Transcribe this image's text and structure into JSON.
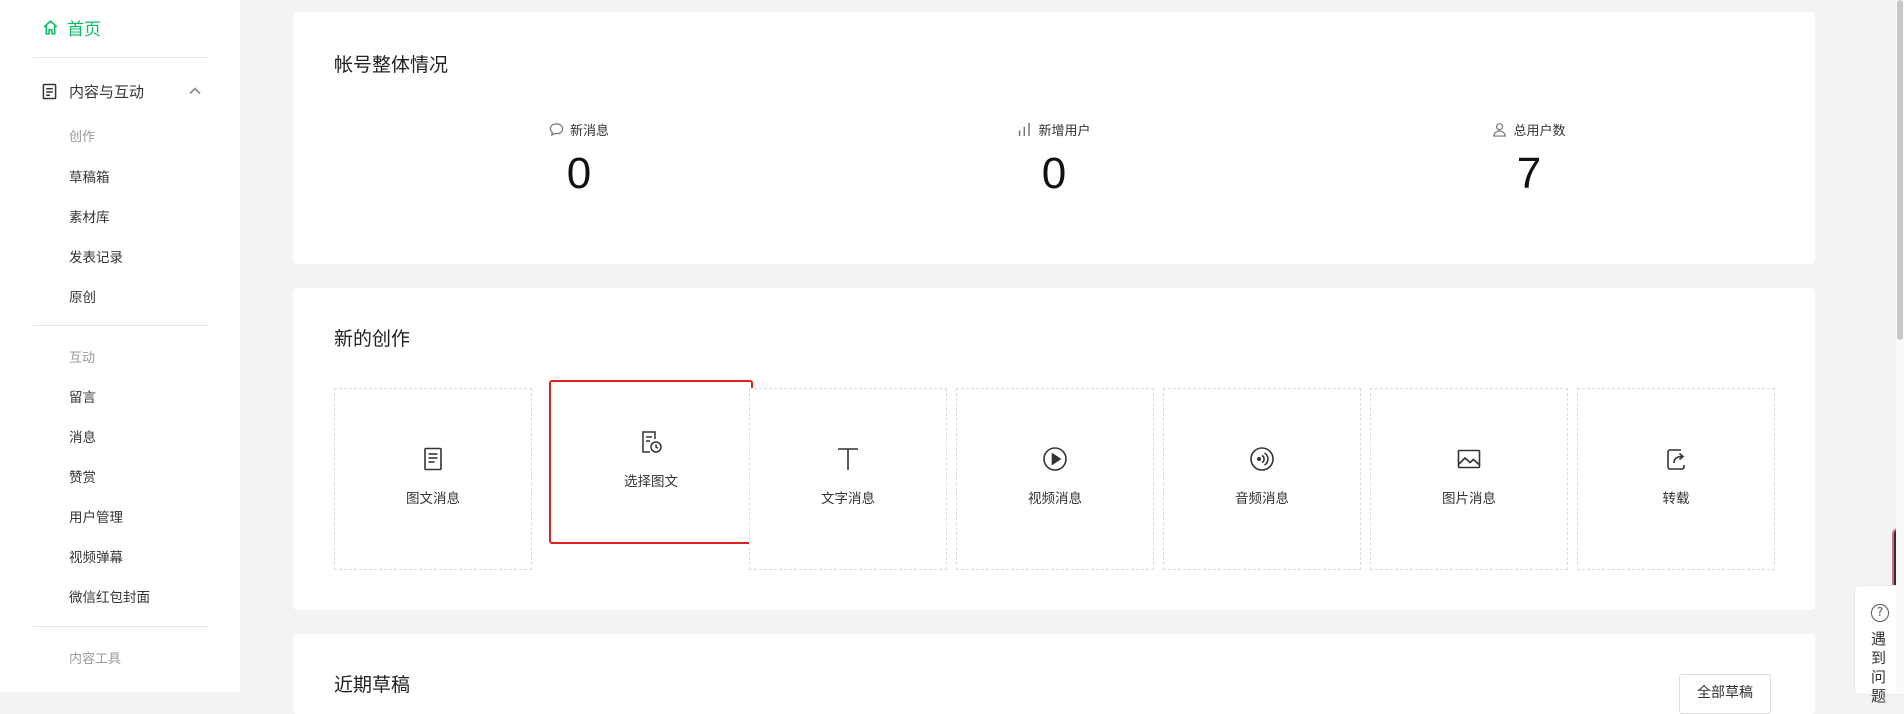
{
  "sidebar": {
    "home": "首页",
    "content_group": "内容与互动",
    "sections": {
      "creation": {
        "label": "创作",
        "items": [
          "草稿箱",
          "素材库",
          "发表记录",
          "原创"
        ]
      },
      "interaction": {
        "label": "互动",
        "items": [
          "留言",
          "消息",
          "赞赏",
          "用户管理",
          "视频弹幕",
          "微信红包封面"
        ]
      },
      "tools": {
        "label": "内容工具"
      }
    }
  },
  "overview": {
    "title": "帐号整体情况",
    "stats": [
      {
        "label": "新消息",
        "value": "0",
        "icon": "chat-bubble-icon"
      },
      {
        "label": "新增用户",
        "value": "0",
        "icon": "bar-chart-icon"
      },
      {
        "label": "总用户数",
        "value": "7",
        "icon": "user-icon"
      }
    ]
  },
  "creation": {
    "title": "新的创作",
    "tiles": [
      {
        "label": "图文消息",
        "icon": "article-icon"
      },
      {
        "label": "选择图文",
        "icon": "select-article-icon"
      },
      {
        "label": "文字消息",
        "icon": "text-icon"
      },
      {
        "label": "视频消息",
        "icon": "play-icon"
      },
      {
        "label": "音频消息",
        "icon": "audio-icon"
      },
      {
        "label": "图片消息",
        "icon": "image-icon"
      },
      {
        "label": "转载",
        "icon": "repost-icon"
      }
    ]
  },
  "recent_drafts": {
    "title": "近期草稿",
    "all_button": "全部草稿"
  },
  "help": {
    "label": "遇到问题"
  },
  "colors": {
    "accent": "#07c160",
    "highlight": "#e02020"
  }
}
